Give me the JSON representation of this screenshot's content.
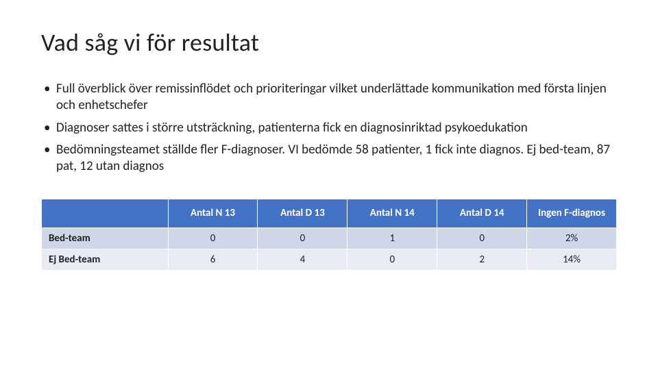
{
  "title": "Vad såg vi för resultat",
  "bullets": [
    "Full överblick över remissinflödet och prioriteringar vilket underlättade kommunikation med första linjen och enhetschefer",
    "Diagnoser sattes i större utsträckning, patienterna fick en diagnosinriktad psykoedukation",
    "Bedömningsteamet ställde fler F-diagnoser. VI bedömde 58 patienter, 1 fick inte diagnos. Ej bed-team, 87 pat, 12 utan diagnos"
  ],
  "table": {
    "columns": [
      "Antal N 13",
      "Antal D 13",
      "Antal N 14",
      "Antal D 14",
      "Ingen F-diagnos"
    ],
    "rows": [
      {
        "label": "Bed-team",
        "cells": [
          "0",
          "0",
          "1",
          "0",
          "2%"
        ]
      },
      {
        "label": "Ej Bed-team",
        "cells": [
          "6",
          "4",
          "0",
          "2",
          "14%"
        ]
      }
    ]
  },
  "chart_data": {
    "type": "table",
    "title": "Vad såg vi för resultat",
    "columns": [
      "Antal N 13",
      "Antal D 13",
      "Antal N 14",
      "Antal D 14",
      "Ingen F-diagnos"
    ],
    "rows": [
      {
        "category": "Bed-team",
        "values": [
          0,
          0,
          1,
          0,
          "2%"
        ]
      },
      {
        "category": "Ej Bed-team",
        "values": [
          6,
          4,
          0,
          2,
          "14%"
        ]
      }
    ]
  }
}
